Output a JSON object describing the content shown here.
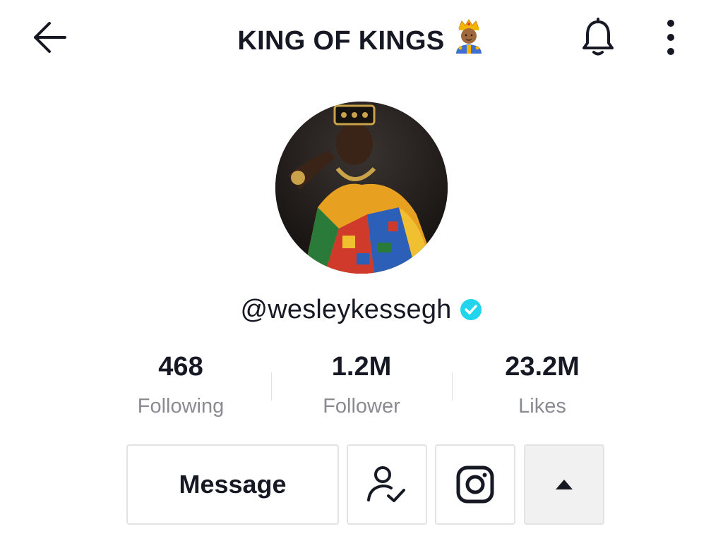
{
  "header": {
    "title": "KING OF KINGS",
    "title_emoji": "prince-emoji",
    "back_icon": "arrow-left-icon",
    "notification_icon": "bell-icon",
    "more_icon": "vertical-dots-icon"
  },
  "profile": {
    "username": "@wesleykessegh",
    "verified": true,
    "verified_color": "#20d5ec"
  },
  "stats": [
    {
      "value": "468",
      "label": "Following"
    },
    {
      "value": "1.2M",
      "label": "Follower"
    },
    {
      "value": "23.2M",
      "label": "Likes"
    }
  ],
  "actions": {
    "message_label": "Message",
    "followed_icon": "person-check-icon",
    "instagram_icon": "instagram-icon",
    "expand_icon": "triangle-up-icon"
  },
  "colors": {
    "text": "#161823",
    "secondary_text": "#8a8b91",
    "border": "#e3e3e4"
  }
}
